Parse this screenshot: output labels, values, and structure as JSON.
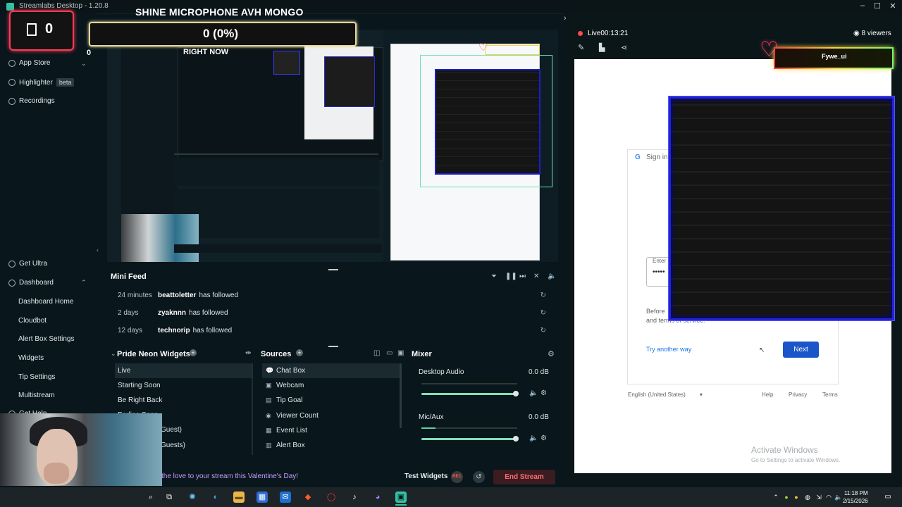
{
  "window": {
    "title": "Streamlabs Desktop - 1.20.8"
  },
  "overlay": {
    "counter_value": "0",
    "goal_title": "SHINE MICROPHONE AVH MONGO",
    "goal_value": "0 (0%)",
    "small_counter": "0",
    "right_now_label": "RIGHT NOW"
  },
  "sidebar": {
    "app_store": "App Store",
    "highlighter": "Highlighter",
    "highlighter_badge": "beta",
    "recordings": "Recordings",
    "get_ultra": "Get Ultra",
    "dashboard": "Dashboard",
    "dashboard_items": [
      "Dashboard Home",
      "Cloudbot",
      "Alert Box Settings",
      "Widgets",
      "Tip Settings",
      "Multistream"
    ],
    "get_help": "Get Help"
  },
  "minifeed": {
    "title": "Mini Feed",
    "rows": [
      {
        "time": "24 minutes",
        "user": "beattoletter",
        "action": "has followed"
      },
      {
        "time": "2 days",
        "user": "zyaknnn",
        "action": "has followed"
      },
      {
        "time": "12 days",
        "user": "technorip",
        "action": "has followed"
      }
    ]
  },
  "scenes": {
    "title": "Pride Neon Widgets",
    "items": [
      "Live",
      "Starting Soon",
      "Be Right Back",
      "Ending Soon",
      "Guest)",
      "Guests)"
    ]
  },
  "sources": {
    "title": "Sources",
    "items": [
      "Chat Box",
      "Webcam",
      "Tip Goal",
      "Viewer Count",
      "Event List",
      "Alert Box"
    ]
  },
  "mixer": {
    "title": "Mixer",
    "channels": [
      {
        "name": "Desktop Audio",
        "db": "0.0 dB",
        "level": 1.0
      },
      {
        "name": "Mic/Aux",
        "db": "0.0 dB",
        "level": 1.0
      }
    ]
  },
  "footer": {
    "banner": "the love to your stream this Valentine's Day!",
    "test_widgets": "Test Widgets",
    "rec_label": "REC",
    "end_stream": "End Stream"
  },
  "stream_panel": {
    "live_label": "Live",
    "live_time": "00:13:21",
    "viewers": "8 viewers",
    "chat_name": "Fywe_ui"
  },
  "signin": {
    "title": "Sign in",
    "enter_label": "Enter",
    "password_mask": "•••••",
    "before_text": "Before",
    "terms_text": "and terms of service.",
    "try_another": "Try another way",
    "next": "Next",
    "language": "English (United States)",
    "help": "Help",
    "privacy": "Privacy",
    "terms": "Terms"
  },
  "activate": {
    "title": "Activate Windows",
    "subtitle": "Go to Settings to activate Windows."
  },
  "taskbar": {
    "time": "11:18 PM",
    "date": "2/15/2026"
  },
  "colors": {
    "accent": "#31c3a2",
    "live": "#ff4a4a",
    "end_stream": "#ff6b73",
    "brick_border": "#2222d6"
  }
}
